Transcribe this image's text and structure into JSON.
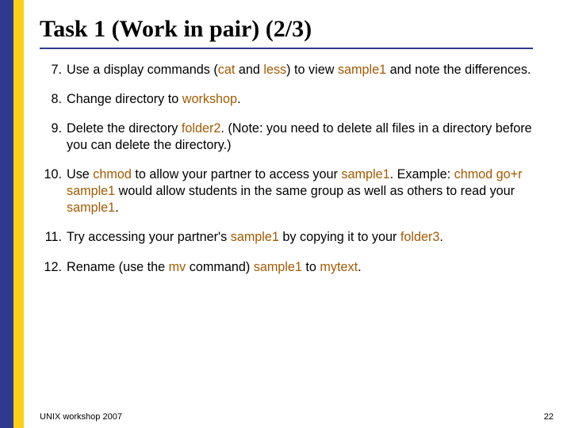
{
  "slide": {
    "title": "Task 1 (Work in pair) (2/3)",
    "footer": "UNIX workshop 2007",
    "page_number": "22"
  },
  "items": [
    {
      "num": "7.",
      "parts": [
        {
          "t": "Use a display commands ("
        },
        {
          "t": "cat",
          "hl": true
        },
        {
          "t": " and "
        },
        {
          "t": "less",
          "hl": true
        },
        {
          "t": ") to view "
        },
        {
          "t": "sample1",
          "hl": true
        },
        {
          "t": " and note the differences."
        }
      ]
    },
    {
      "num": "8.",
      "parts": [
        {
          "t": "Change directory to "
        },
        {
          "t": "workshop",
          "hl": true
        },
        {
          "t": "."
        }
      ]
    },
    {
      "num": "9.",
      "parts": [
        {
          "t": "Delete the directory "
        },
        {
          "t": "folder2",
          "hl": true
        },
        {
          "t": ". (Note: you need to delete all files in a directory before you can delete the directory.)"
        }
      ]
    },
    {
      "num": "10.",
      "parts": [
        {
          "t": "Use "
        },
        {
          "t": "chmod",
          "hl": true
        },
        {
          "t": " to allow your partner to access your "
        },
        {
          "t": "sample1",
          "hl": true
        },
        {
          "t": ". Example: "
        },
        {
          "t": "chmod go+r sample1",
          "hl": true
        },
        {
          "t": " would allow students in the same group as well as others to read your "
        },
        {
          "t": "sample1",
          "hl": true
        },
        {
          "t": "."
        }
      ]
    },
    {
      "num": "11.",
      "parts": [
        {
          "t": "Try accessing your partner's "
        },
        {
          "t": "sample1",
          "hl": true
        },
        {
          "t": " by copying it to your "
        },
        {
          "t": "folder3",
          "hl": true
        },
        {
          "t": "."
        }
      ]
    },
    {
      "num": "12.",
      "parts": [
        {
          "t": "Rename (use the "
        },
        {
          "t": "mv",
          "hl": true
        },
        {
          "t": " command) "
        },
        {
          "t": "sample1",
          "hl": true
        },
        {
          "t": " to "
        },
        {
          "t": "mytext",
          "hl": true
        },
        {
          "t": "."
        }
      ]
    }
  ]
}
